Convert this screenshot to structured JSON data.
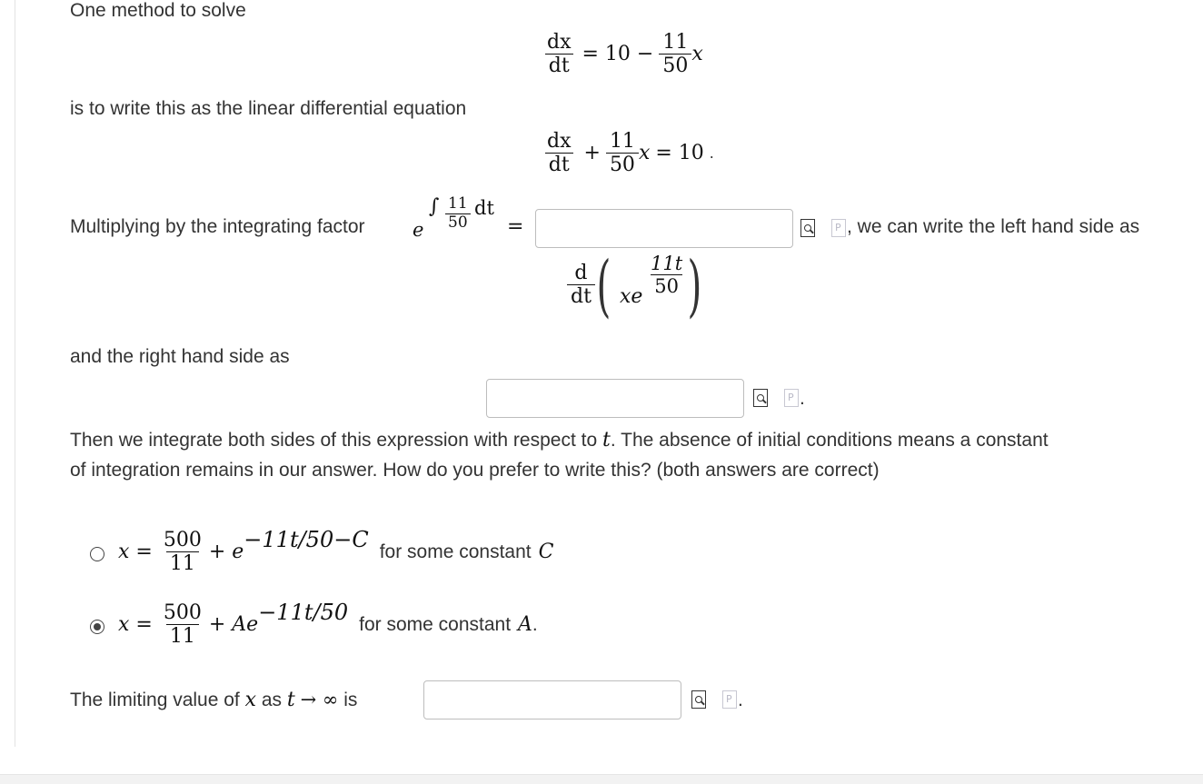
{
  "intro": {
    "line1": "One method to solve",
    "line2": "is to write this as the linear differential equation",
    "multiplying": "Multiplying by the integrating factor",
    "left_side_tail": ", we can write the left hand side as",
    "right_side": "and the right hand side as",
    "integrate_p1": "Then we integrate both sides of this expression with respect to",
    "integrate_t": "t",
    "integrate_p2": ". The absence of initial conditions means a constant",
    "integrate_line2": "of integration remains in our answer. How do you prefer to write this? (both answers are correct)",
    "limit_prefix": "The limiting value of",
    "limit_x": "x",
    "limit_as": "as",
    "limit_t": "t",
    "limit_arrow": "→ ∞",
    "limit_is": "is"
  },
  "equation1": {
    "dx": "dx",
    "dt": "dt",
    "eq": "= 10 −",
    "num": "11",
    "den": "50",
    "x": "x"
  },
  "equation2": {
    "dx": "dx",
    "dt": "dt",
    "plus": "+",
    "num": "11",
    "den": "50",
    "x": "x",
    "eq": "= 10",
    "period": "."
  },
  "integrating_factor": {
    "e": "e",
    "integral": "∫",
    "num": "11",
    "den": "50",
    "dt": "dt",
    "eq": "="
  },
  "lhs_expr": {
    "d": "d",
    "dt": "dt",
    "xe": "xe",
    "exp_num": "11t",
    "exp_den": "50"
  },
  "options": [
    {
      "x": "x =",
      "num": "500",
      "den": "11",
      "rest": "+ e",
      "exp": "−11t/50−C",
      "desc": "for some constant",
      "const": "C",
      "tail": "",
      "selected": false
    },
    {
      "x": "x =",
      "num": "500",
      "den": "11",
      "rest": "+ Ae",
      "exp": "−11t/50",
      "desc": "for some constant",
      "const": "A",
      "tail": ".",
      "selected": true
    }
  ],
  "inputs": {
    "integrating_factor": "",
    "right_hand_side": "",
    "limit": ""
  },
  "icons": {
    "preview": "preview-icon",
    "paste": "paste-icon",
    "paste_glyph": "P"
  }
}
